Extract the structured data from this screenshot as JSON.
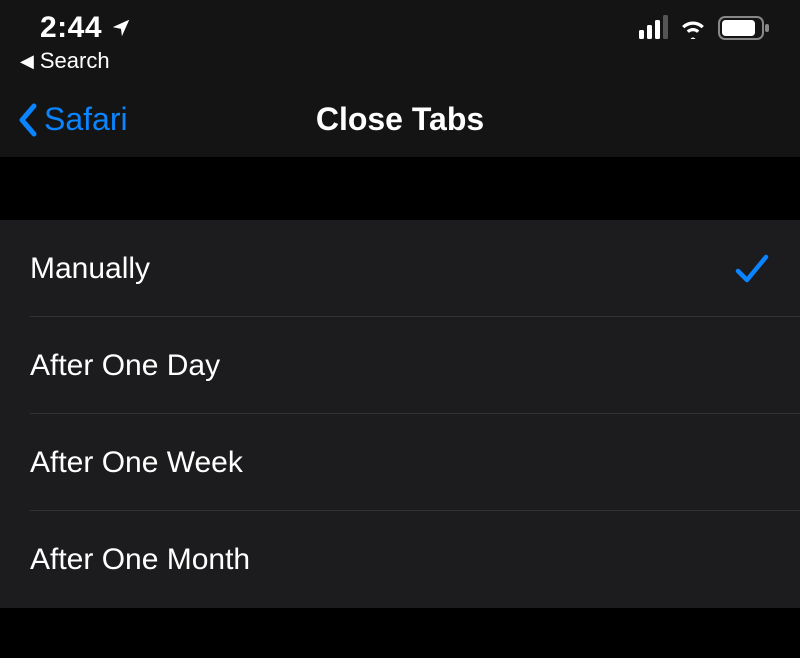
{
  "statusBar": {
    "time": "2:44",
    "breadcrumb": "Search"
  },
  "nav": {
    "backLabel": "Safari",
    "title": "Close Tabs"
  },
  "options": [
    {
      "label": "Manually",
      "selected": true
    },
    {
      "label": "After One Day",
      "selected": false
    },
    {
      "label": "After One Week",
      "selected": false
    },
    {
      "label": "After One Month",
      "selected": false
    }
  ]
}
